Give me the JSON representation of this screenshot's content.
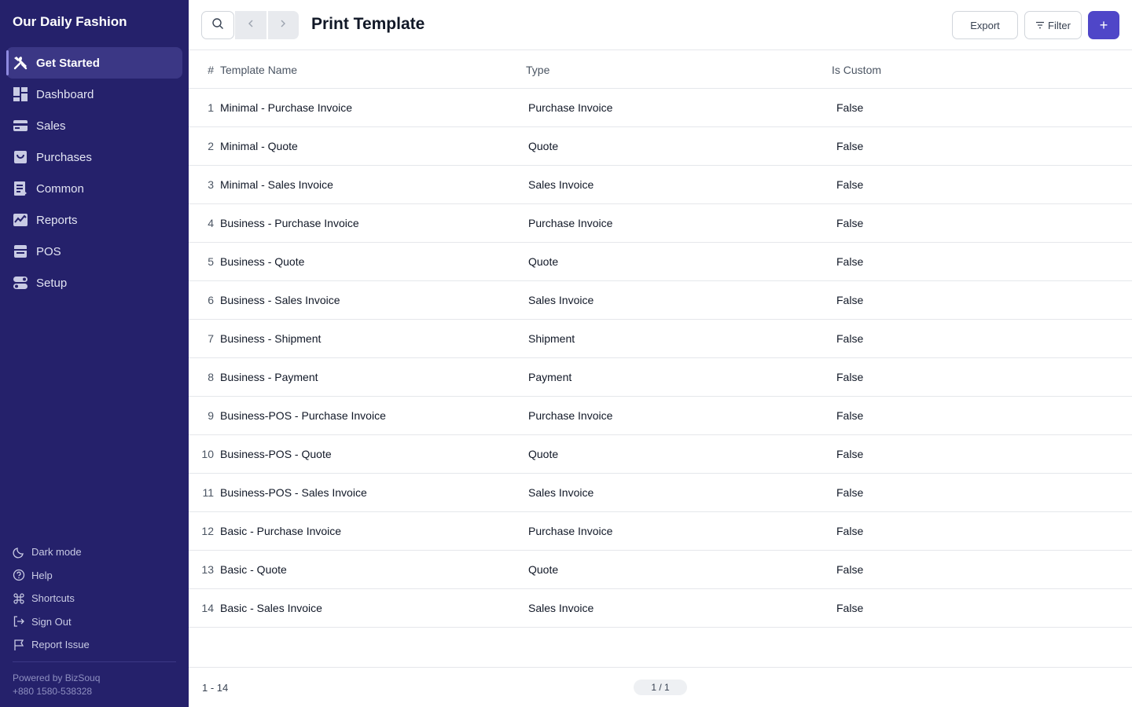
{
  "sidebar": {
    "brand": "Our Daily Fashion",
    "items": [
      {
        "label": "Get Started",
        "icon": "get-started-icon",
        "active": true
      },
      {
        "label": "Dashboard",
        "icon": "dashboard-icon"
      },
      {
        "label": "Sales",
        "icon": "sales-icon"
      },
      {
        "label": "Purchases",
        "icon": "purchases-icon"
      },
      {
        "label": "Common",
        "icon": "common-icon"
      },
      {
        "label": "Reports",
        "icon": "reports-icon"
      },
      {
        "label": "POS",
        "icon": "pos-icon"
      },
      {
        "label": "Setup",
        "icon": "setup-icon"
      }
    ],
    "bottom": [
      {
        "label": "Dark mode",
        "icon": "moon-icon"
      },
      {
        "label": "Help",
        "icon": "help-icon"
      },
      {
        "label": "Shortcuts",
        "icon": "command-icon"
      },
      {
        "label": "Sign Out",
        "icon": "sign-out-icon"
      },
      {
        "label": "Report Issue",
        "icon": "flag-icon"
      }
    ],
    "powered_by": "Powered by BizSouq",
    "phone": "+880 1580-538328"
  },
  "header": {
    "title": "Print Template",
    "export_label": "Export",
    "filter_label": "Filter",
    "add_label": "+"
  },
  "table": {
    "columns": {
      "num": "#",
      "name": "Template Name",
      "type": "Type",
      "custom": "Is Custom"
    },
    "rows": [
      {
        "num": "1",
        "name": "Minimal - Purchase Invoice",
        "type": "Purchase Invoice",
        "custom": "False"
      },
      {
        "num": "2",
        "name": "Minimal - Quote",
        "type": "Quote",
        "custom": "False"
      },
      {
        "num": "3",
        "name": "Minimal - Sales Invoice",
        "type": "Sales Invoice",
        "custom": "False"
      },
      {
        "num": "4",
        "name": "Business - Purchase Invoice",
        "type": "Purchase Invoice",
        "custom": "False"
      },
      {
        "num": "5",
        "name": "Business - Quote",
        "type": "Quote",
        "custom": "False"
      },
      {
        "num": "6",
        "name": "Business - Sales Invoice",
        "type": "Sales Invoice",
        "custom": "False"
      },
      {
        "num": "7",
        "name": "Business - Shipment",
        "type": "Shipment",
        "custom": "False"
      },
      {
        "num": "8",
        "name": "Business - Payment",
        "type": "Payment",
        "custom": "False"
      },
      {
        "num": "9",
        "name": "Business-POS - Purchase Invoice",
        "type": "Purchase Invoice",
        "custom": "False"
      },
      {
        "num": "10",
        "name": "Business-POS - Quote",
        "type": "Quote",
        "custom": "False"
      },
      {
        "num": "11",
        "name": "Business-POS - Sales Invoice",
        "type": "Sales Invoice",
        "custom": "False"
      },
      {
        "num": "12",
        "name": "Basic - Purchase Invoice",
        "type": "Purchase Invoice",
        "custom": "False"
      },
      {
        "num": "13",
        "name": "Basic - Quote",
        "type": "Quote",
        "custom": "False"
      },
      {
        "num": "14",
        "name": "Basic - Sales Invoice",
        "type": "Sales Invoice",
        "custom": "False"
      }
    ]
  },
  "footer": {
    "count": "1 - 14",
    "page": "1 / 1"
  },
  "colors": {
    "sidebar_bg": "#25216b",
    "sidebar_active": "#3b3785",
    "accent": "#4f46c8"
  }
}
